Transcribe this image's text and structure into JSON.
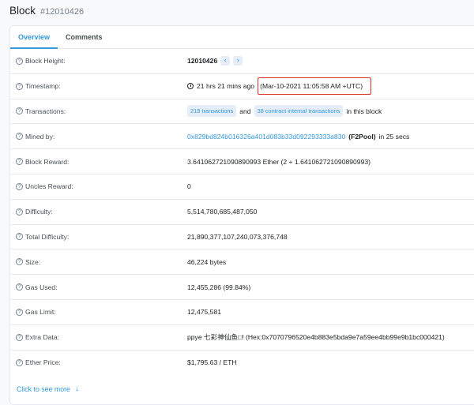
{
  "header": {
    "title": "Block",
    "block_number": "#12010426"
  },
  "tabs": [
    {
      "label": "Overview",
      "active": true
    },
    {
      "label": "Comments",
      "active": false
    }
  ],
  "rows": {
    "block_height": {
      "label": "Block Height:",
      "value": "12010426",
      "prev_icon": "chevron-left-icon",
      "next_icon": "chevron-right-icon"
    },
    "timestamp": {
      "label": "Timestamp:",
      "relative": "21 hrs 21 mins ago",
      "absolute": "(Mar-10-2021 11:05:58 AM +UTC)",
      "icon": "clock-icon"
    },
    "transactions": {
      "label": "Transactions:",
      "tx_pill": "218 transactions",
      "and": "and",
      "internal_pill": "38 contract internal transactions",
      "suffix": "in this block"
    },
    "mined_by": {
      "label": "Mined by:",
      "address": "0x829bd824b016326a401d083b33d092293333a830",
      "pool": "(F2Pool)",
      "suffix": "in 25 secs"
    },
    "block_reward": {
      "label": "Block Reward:",
      "value": "3.641062721090890993 Ether (2 + 1.641062721090890993)"
    },
    "uncles_reward": {
      "label": "Uncles Reward:",
      "value": "0"
    },
    "difficulty": {
      "label": "Difficulty:",
      "value": "5,514,780,685,487,050"
    },
    "total_difficulty": {
      "label": "Total Difficulty:",
      "value": "21,890,377,107,240,073,376,748"
    },
    "size": {
      "label": "Size:",
      "value": "46,224 bytes"
    },
    "gas_used": {
      "label": "Gas Used:",
      "value": "12,455,286 (99.84%)"
    },
    "gas_limit": {
      "label": "Gas Limit:",
      "value": "12,475,581"
    },
    "extra_data": {
      "label": "Extra Data:",
      "value": "ppye 七彩神仙鱼□! (Hex:0x7070796520e4b883e5bda9e7a59ee4bb99e9b1bc000421)"
    },
    "ether_price": {
      "label": "Ether Price:",
      "value": "$1,795.63 / ETH"
    }
  },
  "footer": {
    "see_more": "Click to see more",
    "icon": "arrow-down-icon"
  },
  "colors": {
    "accent": "#3498db",
    "highlight": "#d9332a"
  }
}
